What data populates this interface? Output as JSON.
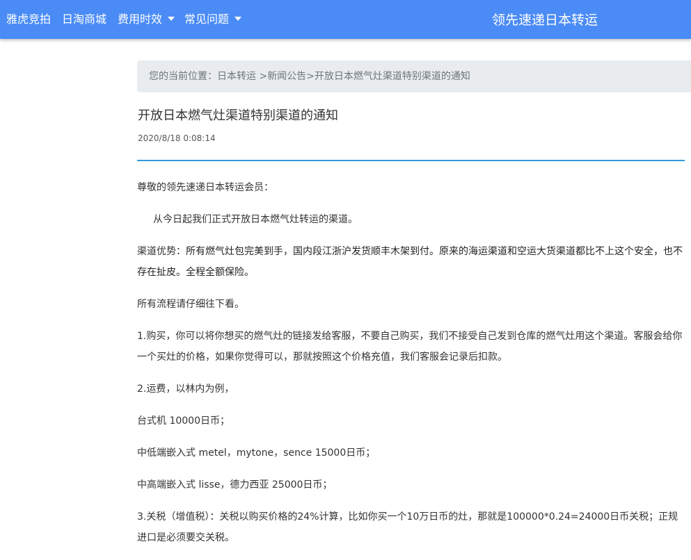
{
  "nav": {
    "items": [
      {
        "label": "雅虎竞拍",
        "dropdown": false
      },
      {
        "label": "日淘商城",
        "dropdown": false
      },
      {
        "label": "费用时效",
        "dropdown": true
      },
      {
        "label": "常见问题",
        "dropdown": true
      }
    ],
    "brand": "领先速递日本转运"
  },
  "breadcrumb": {
    "prefix": "您的当前位置：",
    "home": "日本转运",
    "sep1": " >",
    "section": "新闻公告",
    "sep2": ">",
    "current": "开放日本燃气灶渠道特别渠道的通知"
  },
  "article": {
    "title": "开放日本燃气灶渠道特别渠道的通知",
    "date": "2020/8/18 0:08:14",
    "greeting": "尊敬的领先速递日本转运会员：",
    "intro": "从今日起我们正式开放日本燃气灶转运的渠道。",
    "advantage_label": "渠道优势：",
    "advantage_text": "所有燃气灶包完美到手，国内段江浙沪发货顺丰木架到付。原来的海运渠道和空运大货渠道都比不上这个安全，也不存在扯皮。全程全额保险。",
    "flow_note": "所有流程请仔细往下看。",
    "step1": "1.购买，你可以将你想买的燃气灶的链接发给客服，不要自己购买，我们不接受自己发到仓库的燃气灶用这个渠道。客服会给你一个买灶的价格，如果你觉得可以，那就按照这个价格充值，我们客服会记录后扣款。",
    "step2": "2.运费，以林内为例，",
    "price1": "台式机 10000日币；",
    "price2": "中低端嵌入式 metel，mytone，sence 15000日币；",
    "price3": "中高端嵌入式 lisse，德力西亚 25000日币；",
    "step3": "3.关税（增值税）：关税以购买价格的24%计算，比如你买一个10万日币的灶，那就是100000*0.24=24000日币关税；正规进口是必须要交关税。"
  },
  "colors": {
    "navbar": "#4a8bf5",
    "breadcrumb_bg": "#e9ecef",
    "rule": "#2f9ad8"
  }
}
